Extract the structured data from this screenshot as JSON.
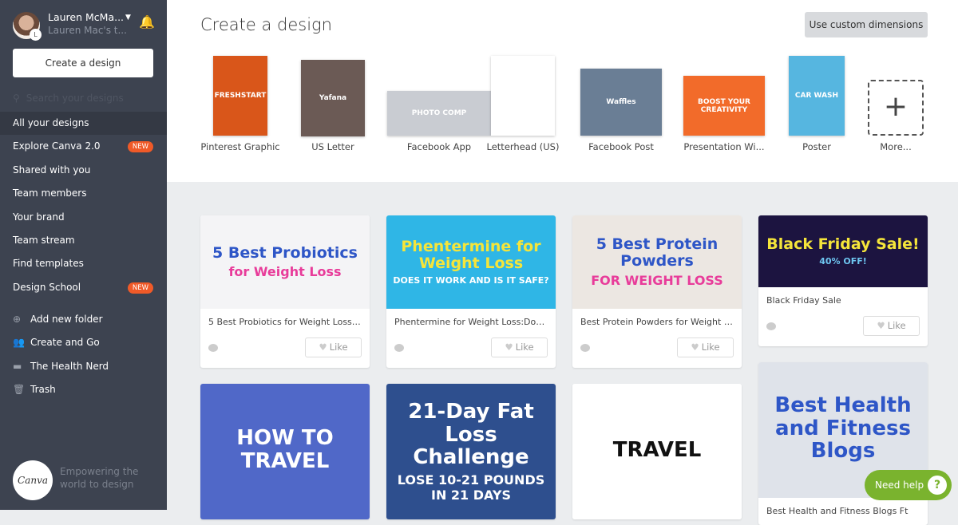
{
  "user": {
    "name": "Lauren McMa...",
    "team": "Lauren Mac's t...",
    "initial": "L"
  },
  "sidebar": {
    "create_label": "Create a design",
    "search_placeholder": "Search your designs",
    "items": [
      {
        "label": "All your designs"
      },
      {
        "label": "Explore Canva 2.0",
        "badge": "NEW"
      },
      {
        "label": "Shared with you"
      },
      {
        "label": "Team members"
      },
      {
        "label": "Your brand"
      },
      {
        "label": "Team stream"
      },
      {
        "label": "Find templates"
      },
      {
        "label": "Design School",
        "badge": "NEW"
      }
    ],
    "folders": [
      {
        "label": "Add new folder",
        "icon": "plus-circle-icon"
      },
      {
        "label": "Create and Go",
        "icon": "people-icon"
      },
      {
        "label": "The Health Nerd",
        "icon": "folder-icon"
      },
      {
        "label": "Trash",
        "icon": "trash-icon"
      }
    ],
    "logo": "Canva",
    "tagline": "Empowering the world to design"
  },
  "header": {
    "title": "Create a design",
    "custom_dimensions": "Use custom dimensions"
  },
  "templates": [
    {
      "label": "Pinterest Graphic",
      "text": "FRESHSTART",
      "color": "#d9561a"
    },
    {
      "label": "US Letter",
      "text": "Yafana",
      "color": "#6b5a55"
    },
    {
      "label": "Facebook App",
      "text": "PHOTO COMP",
      "color": "#c9ccd2"
    },
    {
      "label": "Letterhead (US)",
      "text": "",
      "color": "#ffffff"
    },
    {
      "label": "Facebook Post",
      "text": "Waffles",
      "color": "#6a7e95"
    },
    {
      "label": "Presentation Wi...",
      "text": "BOOST YOUR CREATIVITY",
      "color": "#f26b2a"
    },
    {
      "label": "Poster",
      "text": "CAR WASH",
      "color": "#56b6e0"
    }
  ],
  "more_label": "More...",
  "designs": [
    {
      "title": "5 Best Probiotics for Weight LossA...",
      "h1": "5 Best Probiotics",
      "h2": "for Weight Loss",
      "bg": "#f4f4f6",
      "c1": "#2e56c7",
      "c2": "#e83c9a",
      "like": "Like"
    },
    {
      "title": "Phentermine for Weight Loss:Doe...",
      "h1": "Phentermine for Weight Loss",
      "h2": "DOES IT WORK AND IS IT SAFE?",
      "bg": "#2fb6e6",
      "c1": "#f5e53a",
      "c2": "#ffffff",
      "like": "Like"
    },
    {
      "title": "Best Protein Powders for Weight L...",
      "h1": "5 Best Protein Powders",
      "h2": "FOR WEIGHT LOSS",
      "bg": "#ece7e2",
      "c1": "#2e56c7",
      "c2": "#e83c9a",
      "like": "Like"
    },
    {
      "title": "Black Friday Sale",
      "h1": "Black Friday Sale!",
      "h2": "40% OFF!",
      "bg": "#1c1440",
      "c1": "#f5e53a",
      "c2": "#6ec6f0",
      "like": "Like"
    },
    {
      "title": "",
      "h1": "HOW TO TRAVEL",
      "h2": "",
      "bg": "#5068c8",
      "c1": "#ffffff",
      "c2": "#ffffff"
    },
    {
      "title": "",
      "h1": "21-Day Fat Loss Challenge",
      "h2": "LOSE 10-21 POUNDS IN 21 DAYS",
      "bg": "#2e4f8e",
      "c1": "#ffffff",
      "c2": "#ffffff"
    },
    {
      "title": "",
      "h1": "TRAVEL",
      "h2": "",
      "bg": "#ffffff",
      "c1": "#111111",
      "c2": "#111111"
    },
    {
      "title": "Best Health and Fitness Blogs Ft",
      "h1": "Best Health and Fitness Blogs",
      "h2": "",
      "bg": "#dfe3ea",
      "c1": "#2e56c7",
      "c2": "#2e56c7"
    }
  ],
  "help": {
    "label": "Need help",
    "icon": "?"
  },
  "colors": {
    "sidebar": "#3d4350",
    "accent_new": "#f05a28",
    "help": "#7ab32e"
  }
}
